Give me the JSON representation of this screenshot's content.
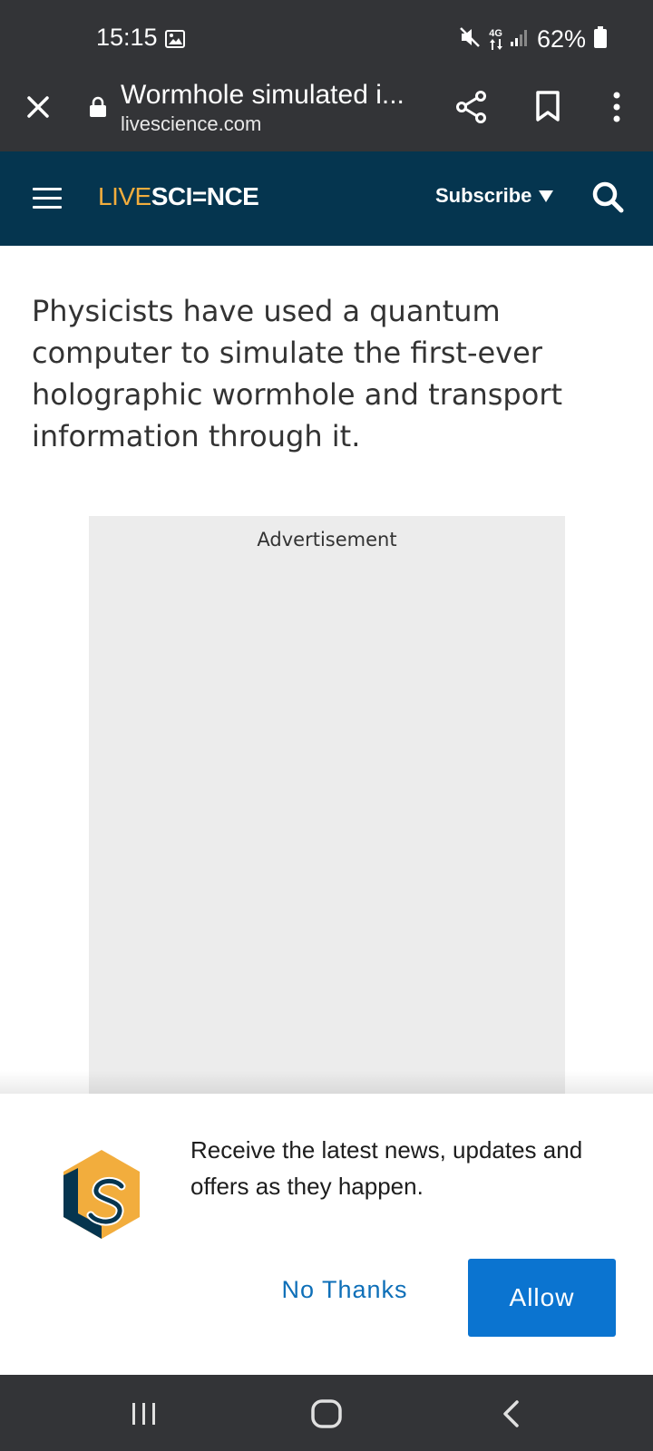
{
  "status_bar": {
    "time": "15:15",
    "network": "4G",
    "battery": "62%"
  },
  "browser": {
    "page_title": "Wormhole simulated i...",
    "domain": "livescience.com"
  },
  "site_header": {
    "logo_part1": "LIVE",
    "logo_part2": "SCI=NCE",
    "subscribe_label": "Subscribe"
  },
  "article": {
    "intro": "Physicists have used a quantum computer to simulate the first-ever holographic wormhole and transport information through it."
  },
  "ad": {
    "label": "Advertisement"
  },
  "notification_prompt": {
    "message": "Receive the latest news, updates and offers as they happen.",
    "no_thanks_label": "No Thanks",
    "allow_label": "Allow"
  },
  "colors": {
    "status_bg": "#333437",
    "header_bg": "#05354f",
    "logo_accent": "#f2ad3d",
    "allow_button": "#0b74d0",
    "no_thanks_text": "#0e6fb8"
  },
  "icons": {
    "status": [
      "gallery-icon",
      "mute-icon",
      "network-4g-icon",
      "signal-icon",
      "battery-icon"
    ],
    "browser": [
      "close-icon",
      "lock-icon",
      "share-icon",
      "bookmark-icon",
      "more-icon"
    ],
    "header": [
      "menu-icon",
      "caret-down-icon",
      "search-icon"
    ],
    "nav": [
      "recents-icon",
      "home-icon",
      "back-icon"
    ]
  }
}
